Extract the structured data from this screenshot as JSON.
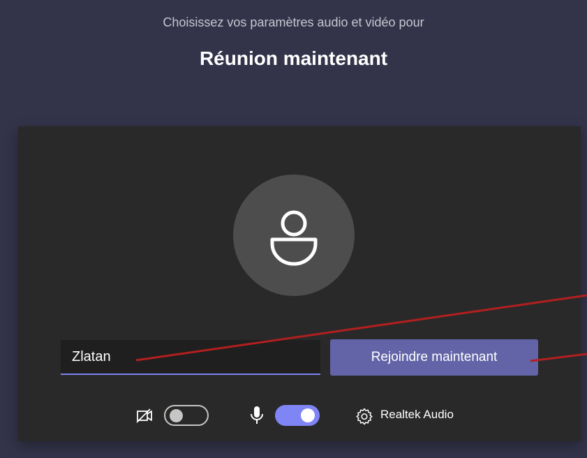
{
  "header": {
    "subtitle": "Choisissez vos paramètres audio et vidéo pour",
    "title": "Réunion maintenant"
  },
  "name_input": {
    "value": "Zlatan"
  },
  "join_button": {
    "label": "Rejoindre maintenant"
  },
  "controls": {
    "camera_toggle": {
      "state": "off"
    },
    "microphone_toggle": {
      "state": "on"
    },
    "audio_device": {
      "label": "Realtek Audio"
    }
  },
  "colors": {
    "background": "#33344a",
    "panel": "#292929",
    "accent": "#6264a7",
    "toggle_on": "#7f85f5",
    "annotation_line": "#b31f1f"
  },
  "icons": {
    "avatar": "person-icon",
    "camera": "video-off-icon",
    "microphone": "microphone-icon",
    "settings": "gear-icon"
  }
}
